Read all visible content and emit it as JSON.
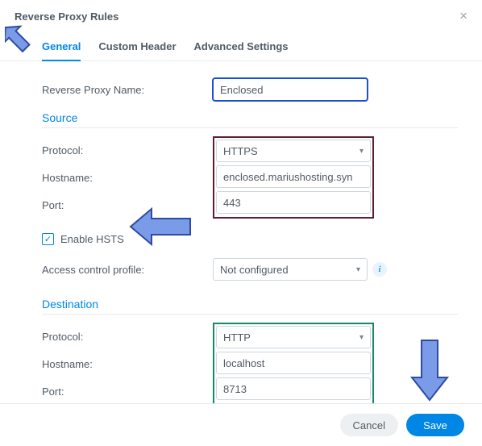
{
  "window": {
    "title": "Reverse Proxy Rules",
    "close_glyph": "×"
  },
  "tabs": {
    "general": "General",
    "custom_header": "Custom Header",
    "advanced": "Advanced Settings"
  },
  "labels": {
    "reverse_proxy_name": "Reverse Proxy Name:",
    "protocol": "Protocol:",
    "hostname": "Hostname:",
    "port": "Port:",
    "enable_hsts": "Enable HSTS",
    "access_control_profile": "Access control profile:"
  },
  "sections": {
    "source": "Source",
    "destination": "Destination"
  },
  "values": {
    "name": "Enclosed",
    "source_protocol": "HTTPS",
    "source_hostname": "enclosed.mariushosting.syn",
    "source_port": "443",
    "access_profile": "Not configured",
    "dest_protocol": "HTTP",
    "dest_hostname": "localhost",
    "dest_port": "8713"
  },
  "icons": {
    "info": "i",
    "check": "✓",
    "chevron_down": "▾"
  },
  "footer": {
    "cancel": "Cancel",
    "save": "Save"
  },
  "annotations": {
    "arrow_fill": "#7a9be8",
    "arrow_stroke": "#2f4aa0"
  }
}
